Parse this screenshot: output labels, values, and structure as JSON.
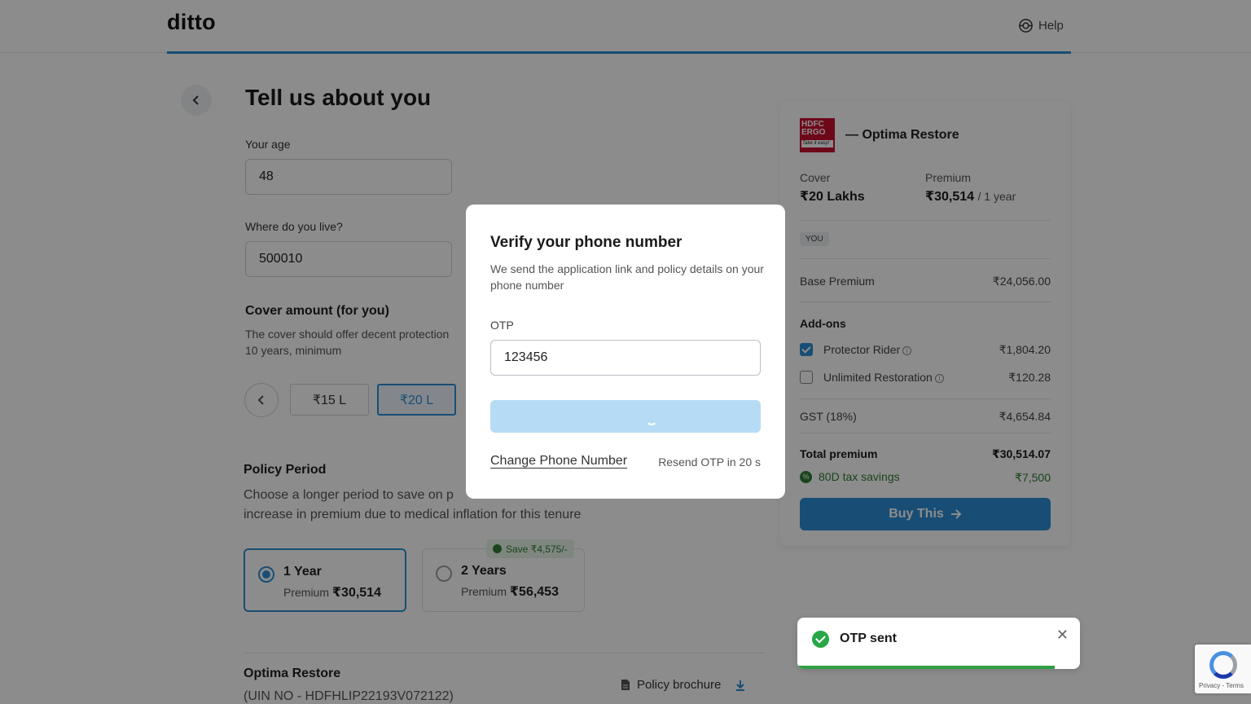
{
  "header": {
    "logo": "ditto",
    "help_label": "Help"
  },
  "page": {
    "title": "Tell us about you"
  },
  "form": {
    "age_label": "Your age",
    "age_value": "48",
    "location_label": "Where do you live?",
    "location_value": "500010",
    "cover_title": "Cover amount (for you)",
    "cover_sub_line1": "The cover should offer decent protection",
    "cover_sub_line2": "10 years, minimum",
    "cover_options": [
      "₹15 L",
      "₹20 L"
    ],
    "cover_selected": "₹20 L"
  },
  "period": {
    "title": "Policy Period",
    "sub_line1": "Choose a longer period to save on p",
    "sub_line2": "increase in premium due to medical inflation for this tenure",
    "save_badge": "Save ₹4,575/-",
    "options": [
      {
        "name": "1 Year",
        "premium_label": "Premium",
        "premium": "₹30,514",
        "selected": true
      },
      {
        "name": "2 Years",
        "premium_label": "Premium",
        "premium": "₹56,453",
        "selected": false
      }
    ]
  },
  "plan_info": {
    "name": "Optima Restore",
    "uin": "(UIN NO - HDFHLIP22193V072122)",
    "brochure_label": "Policy brochure"
  },
  "summary": {
    "insurer_logo_text": "HDFC ERGO",
    "insurer_tagline": "Take it easy!",
    "plan_title": "— Optima Restore",
    "cover_label": "Cover",
    "cover_value": "₹20 Lakhs",
    "premium_label": "Premium",
    "premium_value": "₹30,514",
    "premium_period": "/ 1 year",
    "member_badge": "YOU",
    "base_premium_label": "Base Premium",
    "base_premium_value": "₹24,056.00",
    "addons_title": "Add-ons",
    "addons": [
      {
        "label": "Protector Rider",
        "value": "₹1,804.20",
        "checked": true
      },
      {
        "label": "Unlimited Restoration",
        "value": "₹120.28",
        "checked": false
      }
    ],
    "gst_label": "GST (18%)",
    "gst_value": "₹4,654.84",
    "total_label": "Total premium",
    "total_value": "₹30,514.07",
    "tax_label": "80D tax savings",
    "tax_value": "₹7,500",
    "buy_label": "Buy This"
  },
  "modal": {
    "title": "Verify your phone number",
    "subtitle": "We send the application link and policy details on your phone number",
    "otp_label": "OTP",
    "otp_value": "123456",
    "change_phone": "Change Phone Number",
    "resend": "Resend OTP in 20 s"
  },
  "toast": {
    "message": "OTP sent",
    "close_icon": "close-icon",
    "progress": 0.91
  },
  "recaptcha": {
    "terms": "Privacy - Terms"
  },
  "colors": {
    "accent": "#2d8fd5",
    "success": "#2e7d32",
    "brand_red": "#c8102e"
  }
}
